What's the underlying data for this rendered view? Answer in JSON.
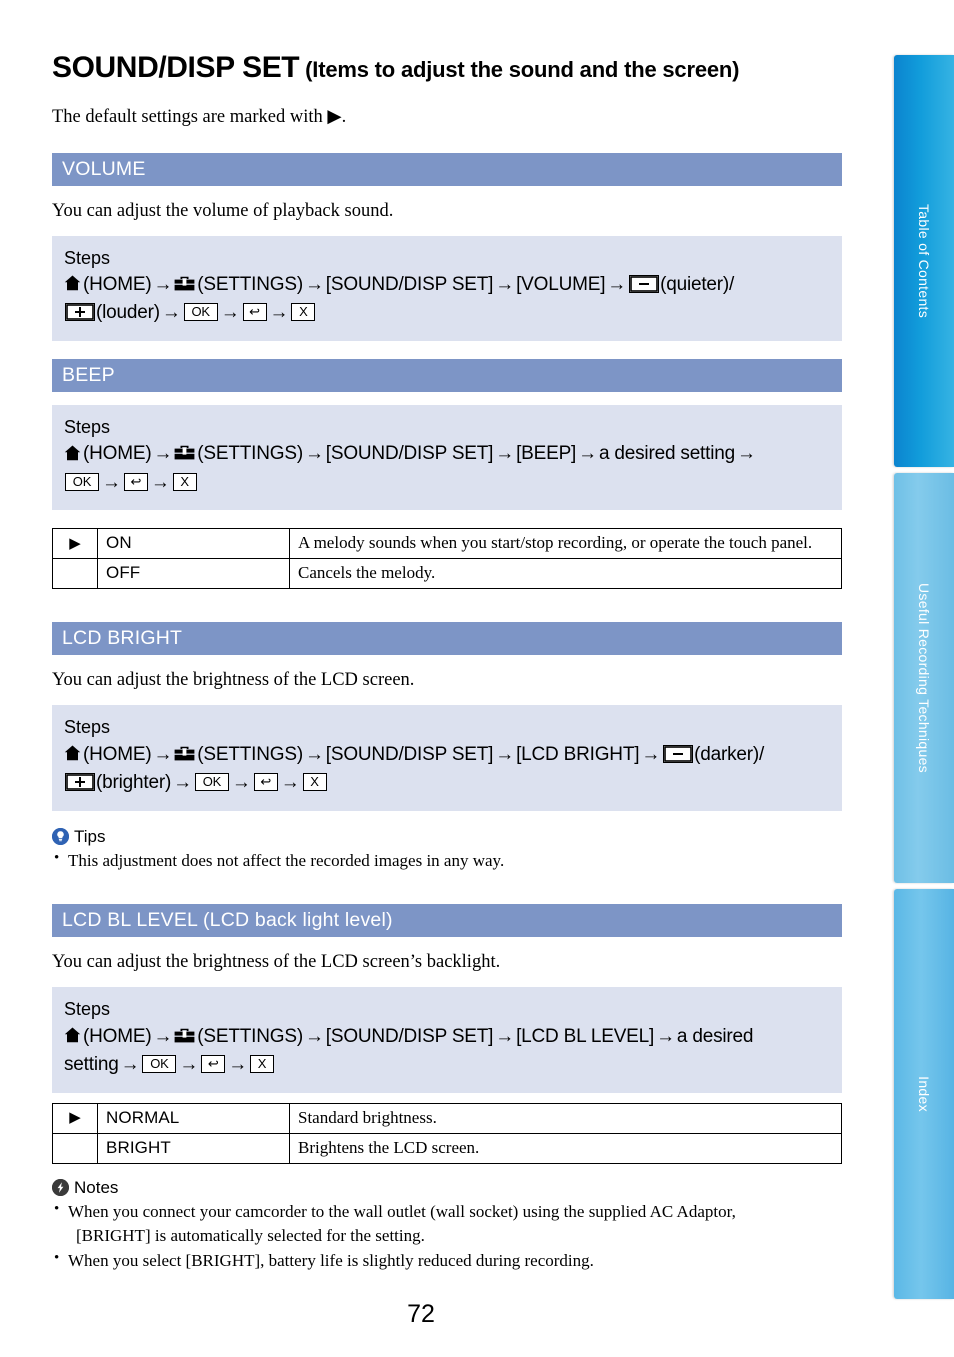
{
  "page": {
    "title_main": "SOUND/DISP SET",
    "title_sub": "(Items to adjust the sound and the screen)",
    "intro_before": "The default settings are marked with",
    "intro_after": ".",
    "default_mark": "▶",
    "page_number": "72"
  },
  "icons": {
    "home": "home-icon",
    "settings": "toolbox-icon",
    "ok": "OK",
    "back": "↩",
    "close": "X",
    "minus": "minus-button-icon",
    "plus": "plus-button-icon",
    "arrow": "→",
    "tips_badge": "lightbulb-icon",
    "notes_badge": "lightning-bolt-icon"
  },
  "labels": {
    "steps": "Steps",
    "home": "(HOME)",
    "settings": "(SETTINGS)",
    "sound_disp_set": "[SOUND/DISP SET]",
    "tips": "Tips",
    "notes": "Notes"
  },
  "sections": [
    {
      "id": "volume",
      "heading": "VOLUME",
      "body": "You can adjust the volume of playback sound.",
      "steps": {
        "target": "[VOLUME]",
        "minus_label": "(quieter)/",
        "plus_label": "(louder)"
      }
    },
    {
      "id": "beep",
      "heading": "BEEP",
      "body": "",
      "steps": {
        "target": "[BEEP]",
        "desired": "a desired setting"
      },
      "options": [
        {
          "mark": "▶",
          "name": "ON",
          "desc": "A melody sounds when you start/stop recording, or operate the touch panel."
        },
        {
          "mark": "",
          "name": "OFF",
          "desc": "Cancels the melody."
        }
      ]
    },
    {
      "id": "lcd-bright",
      "heading": "LCD BRIGHT",
      "body": "You can adjust the brightness of the LCD screen.",
      "steps": {
        "target": "[LCD BRIGHT]",
        "minus_label": "(darker)/",
        "plus_label": "(brighter)"
      },
      "tips": [
        "This adjustment does not affect the recorded images in any way."
      ]
    },
    {
      "id": "lcd-bl-level",
      "heading": "LCD BL LEVEL (LCD back light level)",
      "body": "You can adjust the brightness of the LCD screen’s backlight.",
      "steps": {
        "target": "[LCD BL LEVEL]",
        "desired": "a desired",
        "desired_cont": "setting"
      },
      "options": [
        {
          "mark": "▶",
          "name": "NORMAL",
          "desc": "Standard brightness."
        },
        {
          "mark": "",
          "name": "BRIGHT",
          "desc": "Brightens the LCD screen."
        }
      ],
      "notes": [
        {
          "line1": "When you connect your camcorder to the wall outlet (wall socket) using the supplied AC Adaptor,",
          "line2": "[BRIGHT] is automatically selected for the setting."
        },
        {
          "line1": "When you select [BRIGHT], battery life is slightly reduced during recording.",
          "line2": ""
        }
      ]
    }
  ],
  "tabs": [
    {
      "id": "toc",
      "label": "Table of Contents",
      "color": "#0b84cf"
    },
    {
      "id": "urt",
      "label": "Useful Recording Techniques",
      "color": "#6fc0e6"
    },
    {
      "id": "index",
      "label": "Index",
      "color": "#5bb8e6"
    }
  ]
}
